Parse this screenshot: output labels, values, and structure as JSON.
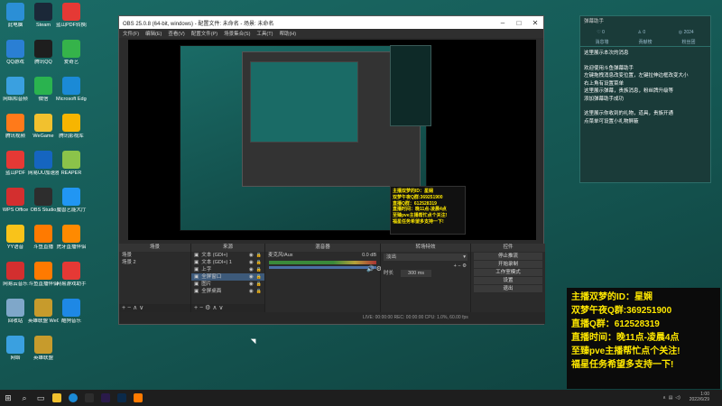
{
  "desktop_icons": [
    {
      "label": "此电脑",
      "color": "#2b8fd6"
    },
    {
      "label": "Steam",
      "color": "#1b2838"
    },
    {
      "label": "蓝山PDF转换器",
      "color": "#e53935"
    },
    {
      "label": "QQ游戏",
      "color": "#2a7fd4"
    },
    {
      "label": "腾讯QQ",
      "color": "#1e1e1e"
    },
    {
      "label": "爱奇艺",
      "color": "#35b34a"
    },
    {
      "label": "网络和音频",
      "color": "#3aa0e0"
    },
    {
      "label": "微信",
      "color": "#2ab34f"
    },
    {
      "label": "Microsoft Edge",
      "color": "#1b8ad6"
    },
    {
      "label": "腾讯视频",
      "color": "#ff7a1a"
    },
    {
      "label": "WeGame",
      "color": "#f2c12e"
    },
    {
      "label": "腾讯影视库",
      "color": "#f7b500"
    },
    {
      "label": "蓝山PDF",
      "color": "#e53935"
    },
    {
      "label": "网易UU加速器",
      "color": "#1565c0"
    },
    {
      "label": "REAPER",
      "color": "#8bc34a"
    },
    {
      "label": "WPS Office",
      "color": "#d32f2f"
    },
    {
      "label": "OBS Studio",
      "color": "#2d2d2d"
    },
    {
      "label": "魔兽艺能大厅",
      "color": "#2196f3"
    },
    {
      "label": "YY语音",
      "color": "#f9c31a"
    },
    {
      "label": "斗鱼直播",
      "color": "#ff7a00"
    },
    {
      "label": "虎牙直播伴侣",
      "color": "#ff8a00"
    },
    {
      "label": "网易云音乐",
      "color": "#d32f2f"
    },
    {
      "label": "斗鱼直播伴侣",
      "color": "#ff7a00"
    },
    {
      "label": "网易游戏助手",
      "color": "#e53935"
    },
    {
      "label": "回收站",
      "color": "#7fa7c9"
    },
    {
      "label": "英雄联盟 WeGame版",
      "color": "#c79b2c"
    },
    {
      "label": "酷狗音乐",
      "color": "#1e88e5"
    },
    {
      "label": "网络",
      "color": "#3aa0e0"
    },
    {
      "label": "英雄联盟",
      "color": "#c79b2c"
    }
  ],
  "obs": {
    "title": "OBS 25.0.8 (64-bit, windows) - 配置文件: 未命名 - 场景: 未命名",
    "menu": [
      "文件(F)",
      "编辑(E)",
      "查看(V)",
      "配置文件(P)",
      "场景集合(S)",
      "工具(T)",
      "帮助(H)"
    ],
    "docks": {
      "scenes": {
        "header": "场景",
        "items": [
          "场景",
          "场景 2"
        ]
      },
      "sources": {
        "header": "来源",
        "items": [
          "文本 (GDI+)",
          "文本 (GDI+) 1",
          "上字",
          "全屏窗口",
          "图片",
          "全屏桌面"
        ],
        "selected": 3
      },
      "mixer": {
        "header": "混音器",
        "channel": "麦克风/Aux",
        "level": "0.0 dB"
      },
      "transitions": {
        "header": "转场特效",
        "type": "淡出",
        "duration_label": "时长",
        "duration": "300 ms"
      },
      "controls": {
        "header": "控件",
        "buttons": [
          "停止推流",
          "开始录制",
          "工作室模式",
          "设置",
          "退出"
        ]
      }
    },
    "status": "LIVE: 00:00:00   REC: 00:00:00   CPU: 1.0%, 60.00 fps"
  },
  "preview_overlay": [
    "主播双梦的ID：星娴",
    "双梦午夜Q群:369251900",
    "直播Q群：612528319",
    "直播时间：晚11点-凌晨4点",
    "至臻pve主播帮忙点个关注!",
    "福星任务希望多支持一下!"
  ],
  "chat": {
    "header": "弹幕助手",
    "stats": [
      "0",
      "0",
      "2024"
    ],
    "tabs": [
      "消息墙",
      "贡献榜",
      "粉丝团"
    ],
    "messages": [
      "这里展示本次的消息",
      "",
      "欢迎使用斗鱼弹幕助手",
      "左键拖拽消息改变位置，左键拉伸边框改变大小",
      "右上角有设置菜单",
      "这里展示弹幕，贵族消息，粉丝牌升级等",
      "添加弹幕助手成功",
      "",
      "这里展示你收到的礼物，道具，贵族开通",
      "点菜单可设置小礼物屏蔽"
    ]
  },
  "overlay": [
    "主播双梦的ID：星娴",
    "双梦午夜Q群:369251900",
    "直播Q群：612528319",
    "直播时间：晚11点-凌晨4点",
    "至臻pve主播帮忙点个关注!",
    "福星任务希望多支持一下!"
  ],
  "taskbar": {
    "apps": [
      {
        "name": "obs-taskbar-icon",
        "color": "#2d2d2d"
      },
      {
        "name": "premiere-taskbar-icon",
        "color": "#2a1a4a"
      },
      {
        "name": "photoshop-taskbar-icon",
        "color": "#0b2a4a"
      },
      {
        "name": "douyu-taskbar-icon",
        "color": "#ff7a00"
      }
    ],
    "time": "1:00",
    "date": "2022/6/29"
  }
}
